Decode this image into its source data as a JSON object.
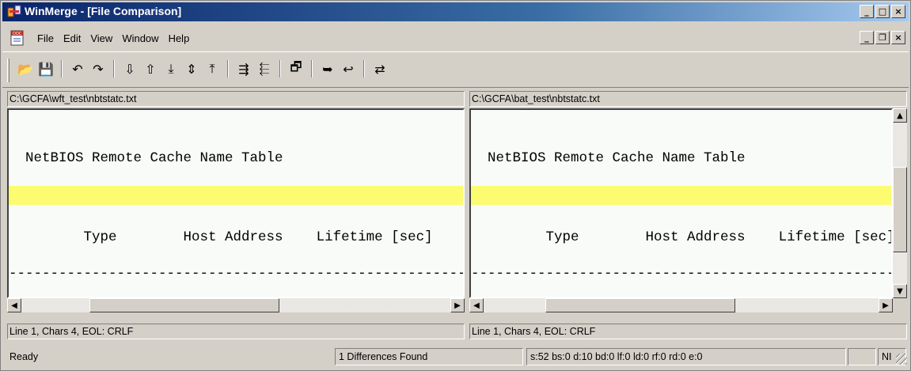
{
  "window": {
    "title": "WinMerge - [File Comparison]"
  },
  "caption_buttons": {
    "minimize": "_",
    "maximize": "□",
    "close": "×"
  },
  "menu": {
    "items": [
      {
        "label": "File"
      },
      {
        "label": "Edit"
      },
      {
        "label": "View"
      },
      {
        "label": "Window"
      },
      {
        "label": "Help"
      }
    ],
    "mdi_buttons": {
      "minimize": "_",
      "restore": "❐",
      "close": "×"
    }
  },
  "toolbar": {
    "groups": [
      [
        {
          "icon": "open-icon",
          "glyph": "📂"
        },
        {
          "icon": "save-icon",
          "glyph": "💾"
        }
      ],
      [
        {
          "icon": "undo-icon",
          "glyph": "↶"
        },
        {
          "icon": "redo-icon",
          "glyph": "↷"
        }
      ],
      [
        {
          "icon": "next-diff-icon",
          "glyph": "⇩"
        },
        {
          "icon": "prev-diff-icon",
          "glyph": "⇧"
        },
        {
          "icon": "last-diff-icon",
          "glyph": "⤓"
        },
        {
          "icon": "current-diff-icon",
          "glyph": "⇕"
        },
        {
          "icon": "first-diff-icon",
          "glyph": "⤒"
        }
      ],
      [
        {
          "icon": "copy-right-icon",
          "glyph": "⇶"
        },
        {
          "icon": "copy-left-icon",
          "glyph": "⬱"
        }
      ],
      [
        {
          "icon": "options-icon",
          "glyph": "🗗"
        }
      ],
      [
        {
          "icon": "merge-right-icon",
          "glyph": "➥"
        },
        {
          "icon": "merge-left-icon",
          "glyph": "↩"
        }
      ],
      [
        {
          "icon": "refresh-icon",
          "glyph": "⇄"
        }
      ]
    ]
  },
  "left_pane": {
    "path": "C:\\GCFA\\wft_test\\nbtstatc.txt",
    "lines": [
      "",
      "  NetBIOS Remote Cache Name Table",
      "",
      "",
      "         Type        Host Address    Lifetime [sec]",
      "",
      "------------------------------------------------------------"
    ],
    "position": "Line 1, Chars 4, EOL: CRLF"
  },
  "right_pane": {
    "path": "C:\\GCFA\\bat_test\\nbtstatc.txt",
    "lines": [
      "",
      "  NetBIOS Remote Cache Name Table",
      "",
      "",
      "         Type        Host Address    Lifetime [sec]",
      "",
      "------------------------------------------------------------"
    ],
    "position": "Line 1, Chars 4, EOL: CRLF"
  },
  "colors": {
    "diff_highlight": "#fcfc70",
    "editor_bg": "#f8fbf8",
    "title_start": "#0a246a",
    "title_end": "#a6caf0"
  },
  "statusbar": {
    "status": "Ready",
    "differences": "1 Differences Found",
    "stats": "s:52 bs:0 d:10 bd:0 lf:0 ld:0 rf:0 rd:0 e:0",
    "mode": "NI"
  }
}
